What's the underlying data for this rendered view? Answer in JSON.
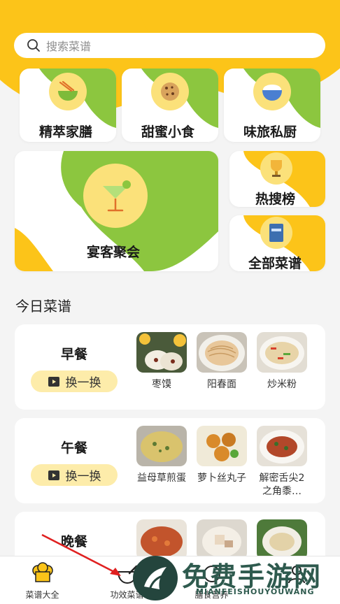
{
  "search": {
    "placeholder": "搜索菜谱"
  },
  "categories": [
    {
      "label": "精萃家膳",
      "icon": "noodle-bowl-icon"
    },
    {
      "label": "甜蜜小食",
      "icon": "cookie-icon"
    },
    {
      "label": "味旅私厨",
      "icon": "rice-bowl-icon"
    },
    {
      "label": "宴客聚会",
      "icon": "cocktail-icon"
    },
    {
      "label": "热搜榜",
      "icon": "trophy-icon"
    },
    {
      "label": "全部菜谱",
      "icon": "menu-book-icon"
    }
  ],
  "today": {
    "title": "今日菜谱",
    "swap_label": "换一换",
    "meals": [
      {
        "name": "早餐",
        "dishes": [
          "枣馍",
          "阳春面",
          "炒米粉"
        ]
      },
      {
        "name": "午餐",
        "dishes": [
          "益母草煎蛋",
          "萝卜丝丸子",
          "解密舌尖2之角黍…"
        ]
      },
      {
        "name": "晚餐",
        "dishes": [
          "",
          "",
          ""
        ]
      }
    ]
  },
  "tabs": [
    {
      "label": "菜谱大全",
      "icon": "chef-hat-icon"
    },
    {
      "label": "功效菜谱",
      "icon": "mortar-icon"
    },
    {
      "label": "膳食营养",
      "icon": "nutrition-icon"
    },
    {
      "label": "",
      "icon": "profile-icon"
    }
  ],
  "watermark": {
    "main": "免费手游网",
    "sub": "MIANFEISHOUYOUWANG"
  },
  "colors": {
    "yellow": "#fcc419",
    "green": "#8cc63f",
    "icon_bg": "#fbe17a",
    "swap_bg": "#fdecaa"
  }
}
